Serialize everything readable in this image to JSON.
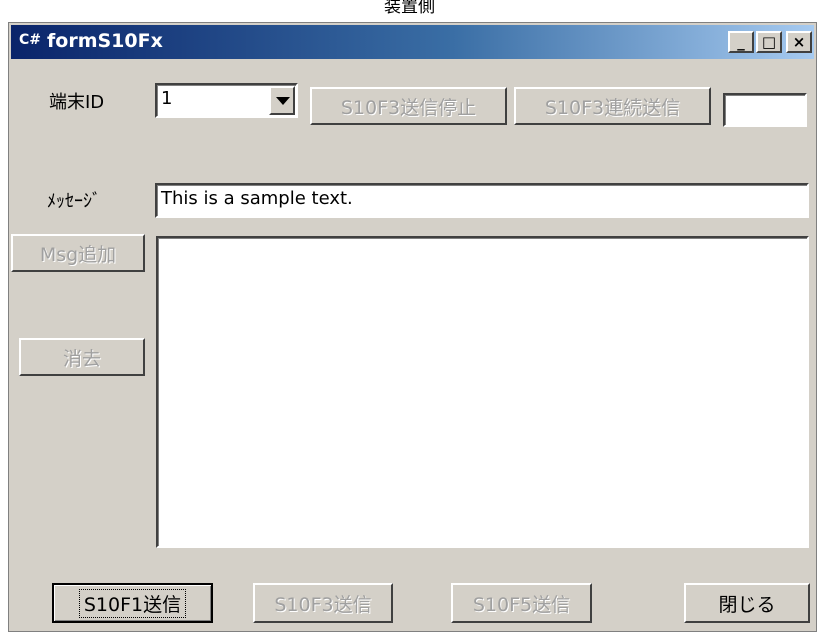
{
  "caption": "装置側",
  "window": {
    "icon": "C#",
    "title": "formS10Fx",
    "minimize": "_",
    "maximize": "□",
    "close": "×"
  },
  "terminal": {
    "label": "端末ID",
    "value": "1"
  },
  "buttons": {
    "stop_s10f3": "S10F3送信停止",
    "continuous_s10f3": "S10F3連続送信",
    "add_msg": "Msg追加",
    "clear": "消去",
    "send_s10f1": "S10F1送信",
    "send_s10f3": "S10F3送信",
    "send_s10f5": "S10F5送信",
    "close": "閉じる"
  },
  "count_field": "",
  "message": {
    "label": "ﾒｯｾｰｼﾞ",
    "value": "This is a sample text."
  },
  "log": ""
}
